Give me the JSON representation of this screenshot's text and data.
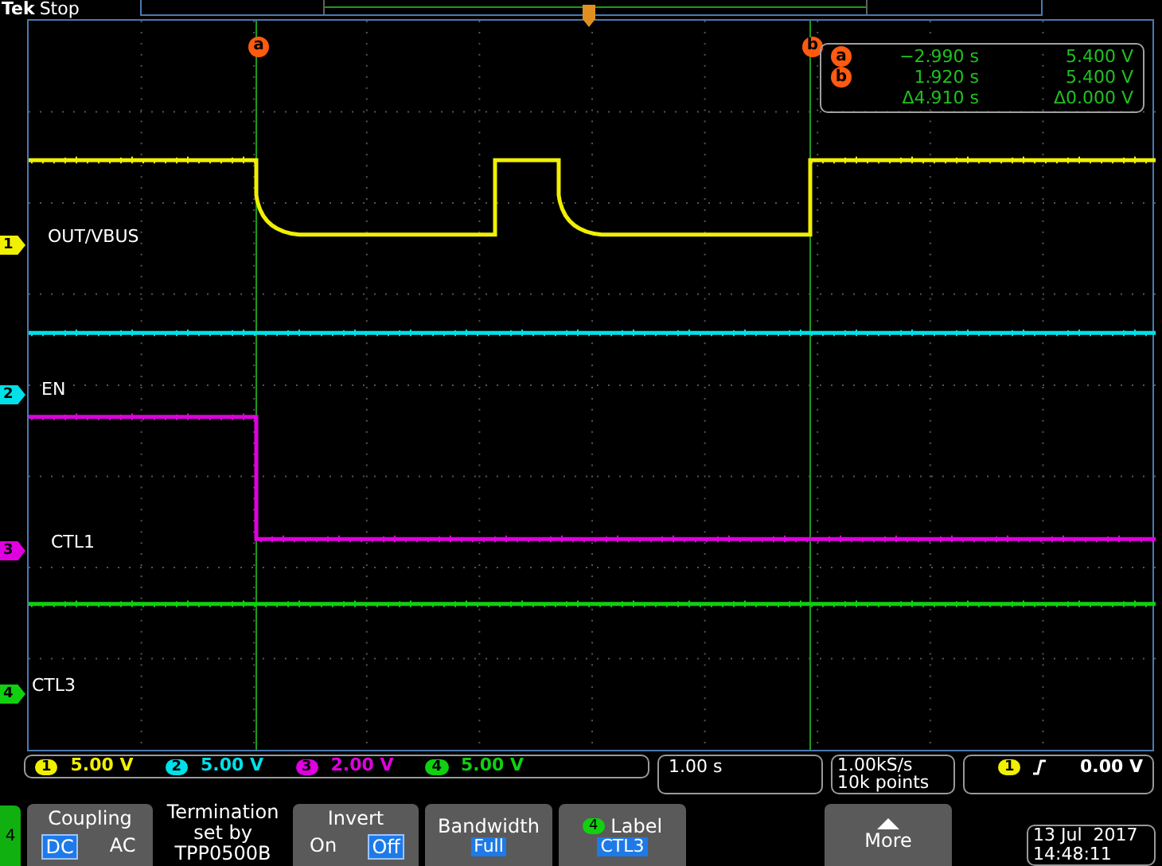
{
  "header": {
    "brand": "Tek",
    "status": "Stop"
  },
  "cursors": [
    {
      "label": "a",
      "readout_label": "a",
      "time": "−2.990 s",
      "volts": "5.400 V"
    },
    {
      "label": "b",
      "readout_label": "b",
      "time": "1.920 s",
      "volts": "5.400 V"
    }
  ],
  "delta": {
    "time": "Δ4.910 s",
    "volts": "Δ0.000 V"
  },
  "channels": [
    {
      "number": "1",
      "label": "OUT/VBUS",
      "color": "#f0f000",
      "scale_number": "1",
      "scale": "5.00 V"
    },
    {
      "number": "2",
      "label": "EN",
      "color": "#00e0e8",
      "scale_number": "2",
      "scale": "5.00 V"
    },
    {
      "number": "3",
      "label": "CTL1",
      "color": "#e000e0",
      "scale_number": "3",
      "scale": "2.00 V"
    },
    {
      "number": "4",
      "label": "CTL3",
      "color": "#10d010",
      "scale_number": "4",
      "scale": "5.00 V"
    }
  ],
  "timebase": "1.00 s",
  "acquisition": {
    "sample_rate": "1.00kS/s",
    "record_length": "10k points"
  },
  "trigger": {
    "source": "1",
    "level": "0.00 V"
  },
  "menu": {
    "channel": "4",
    "buttons": [
      {
        "kind": "toggle",
        "title": "Coupling",
        "options": [
          {
            "label": "DC",
            "selected": true
          },
          {
            "label": "AC",
            "selected": false
          }
        ]
      },
      {
        "kind": "info",
        "lines": [
          "Termination",
          "set by",
          "TPP0500B"
        ]
      },
      {
        "kind": "toggle",
        "title": "Invert",
        "options": [
          {
            "label": "On",
            "selected": false
          },
          {
            "label": "Off",
            "selected": true
          }
        ]
      },
      {
        "kind": "value",
        "title": "Bandwidth",
        "value": "Full"
      },
      {
        "kind": "value",
        "title": "Label",
        "badge": "4",
        "value": "CTL3"
      },
      {
        "kind": "more",
        "title": "More"
      }
    ]
  },
  "clock": {
    "date": "13 Jul  2017",
    "time": "14:48:11"
  }
}
